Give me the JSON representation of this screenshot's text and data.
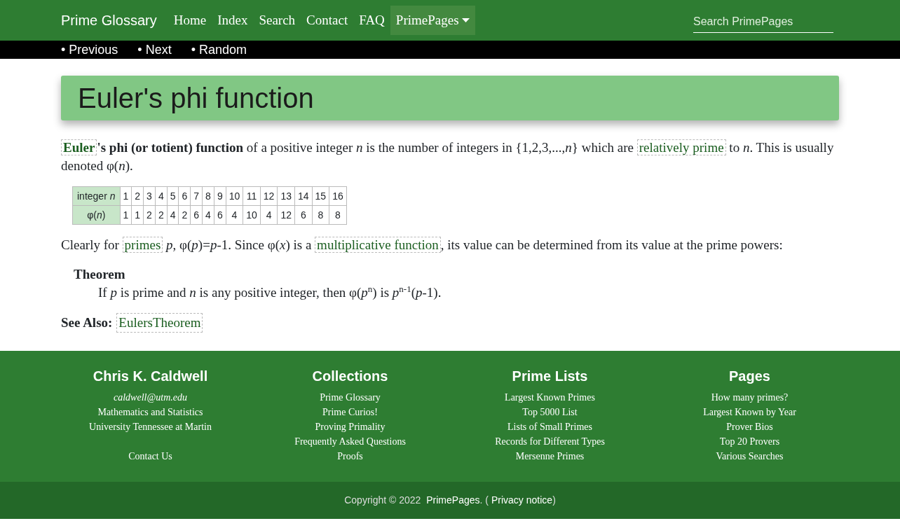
{
  "navbar": {
    "brand": "Prime Glossary",
    "items": [
      {
        "label": "Home",
        "selected": false,
        "dropdown": false
      },
      {
        "label": "Index",
        "selected": false,
        "dropdown": false
      },
      {
        "label": "Search",
        "selected": false,
        "dropdown": false
      },
      {
        "label": "Contact",
        "selected": false,
        "dropdown": false
      },
      {
        "label": "FAQ",
        "selected": false,
        "dropdown": false
      },
      {
        "label": "PrimePages",
        "selected": true,
        "dropdown": true
      }
    ],
    "search": {
      "placeholder": "Search PrimePages"
    }
  },
  "subnav": [
    "• Previous",
    "• Next",
    "• Random"
  ],
  "title": "Euler's phi function",
  "intro": [
    {
      "kind": "link",
      "text": "**Euler**"
    },
    {
      "kind": "text",
      "text": "**'s phi (or totient) function** of a positive integer *n* is the number of integers in {1,2,3,...,*n*} which are "
    },
    {
      "kind": "link",
      "text": "relatively prime"
    },
    {
      "kind": "text",
      "text": " to *n*. This is usually denoted φ(*n*)."
    }
  ],
  "table": {
    "rows": [
      {
        "header": "integer *n*",
        "cells": [
          "1",
          "2",
          "3",
          "4",
          "5",
          "6",
          "7",
          "8",
          "9",
          "10",
          "11",
          "12",
          "13",
          "14",
          "15",
          "16"
        ]
      },
      {
        "header": "φ(*n*)",
        "cells": [
          "1",
          "1",
          "2",
          "2",
          "4",
          "2",
          "6",
          "4",
          "6",
          "4",
          "10",
          "4",
          "12",
          "6",
          "8",
          "8"
        ]
      }
    ]
  },
  "paragraph": [
    {
      "kind": "text",
      "text": "Clearly for "
    },
    {
      "kind": "link",
      "text": "primes"
    },
    {
      "kind": "text",
      "text": " *p*, φ(*p*)=*p*-1. Since φ(*x*) is a "
    },
    {
      "kind": "link",
      "text": "multiplicative function"
    },
    {
      "kind": "text",
      "text": ", its value can be determined from its value at the prime powers:"
    }
  ],
  "theorem": {
    "heading": "Theorem",
    "statement": "If *p* is prime and *n* is any positive integer, then φ(*p*$^{n}$) is *p*$^{n-1}$(*p*-1)."
  },
  "see_also": {
    "label": "See Also:",
    "links": [
      "EulersTheorem"
    ]
  },
  "footer": {
    "columns": [
      {
        "heading": "Chris K. Caldwell",
        "items": [
          {
            "kind": "email",
            "text": "caldwell@utm.edu"
          },
          {
            "kind": "link",
            "text": "Mathematics and Statistics"
          },
          {
            "kind": "link",
            "text": "University Tennessee at Martin"
          },
          {
            "kind": "spaced_link",
            "text": "Contact Us"
          }
        ]
      },
      {
        "heading": "Collections",
        "items": [
          {
            "kind": "link",
            "text": "Prime Glossary"
          },
          {
            "kind": "link",
            "text": "Prime Curios!"
          },
          {
            "kind": "link",
            "text": "Proving Primality"
          },
          {
            "kind": "link",
            "text": "Frequently Asked Questions"
          },
          {
            "kind": "link",
            "text": "Proofs"
          }
        ]
      },
      {
        "heading": "Prime Lists",
        "items": [
          {
            "kind": "link",
            "text": "Largest Known Primes"
          },
          {
            "kind": "link",
            "text": "Top 5000 List"
          },
          {
            "kind": "link",
            "text": "Lists of Small Primes"
          },
          {
            "kind": "link",
            "text": "Records for Different Types"
          },
          {
            "kind": "link",
            "text": "Mersenne Primes"
          }
        ]
      },
      {
        "heading": "Pages",
        "items": [
          {
            "kind": "link",
            "text": "How many primes?"
          },
          {
            "kind": "link",
            "text": "Largest Known by Year"
          },
          {
            "kind": "link",
            "text": "Prover Bios"
          },
          {
            "kind": "link",
            "text": "Top 20 Provers"
          },
          {
            "kind": "link",
            "text": "Various Searches"
          }
        ]
      }
    ],
    "copyright": [
      {
        "kind": "text",
        "text": "Copyright © 2022 "
      },
      {
        "kind": "link",
        "text": "PrimePages"
      },
      {
        "kind": "text",
        "text": ". ("
      },
      {
        "kind": "link",
        "text": "Privacy notice"
      },
      {
        "kind": "text",
        "text": ")"
      }
    ]
  }
}
